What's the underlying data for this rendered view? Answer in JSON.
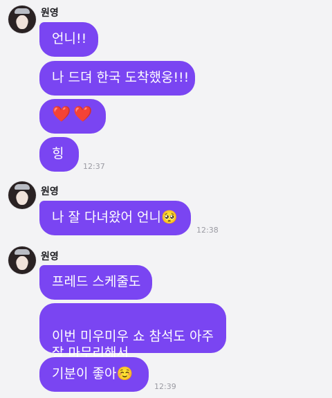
{
  "groups": [
    {
      "sender": "원영",
      "messages": [
        "언니!!",
        "나 드뎌 한국 도착했웅!!!",
        "❤️❤️",
        "힝"
      ],
      "time": "12:37"
    },
    {
      "sender": "원영",
      "messages": [
        "나 잘 다녀왔어 언니🥺"
      ],
      "time": "12:38"
    },
    {
      "sender": "원영",
      "messages": [
        "프레드 스케줄도",
        "이번 미우미우 쇼 참석도 아주\n잘 마무리해서",
        "기분이 좋아☺️"
      ],
      "time": "12:39"
    }
  ],
  "colors": {
    "bubble": "#7a45f2",
    "background": "#f3f3f5",
    "timestamp": "#9a9aa2"
  }
}
